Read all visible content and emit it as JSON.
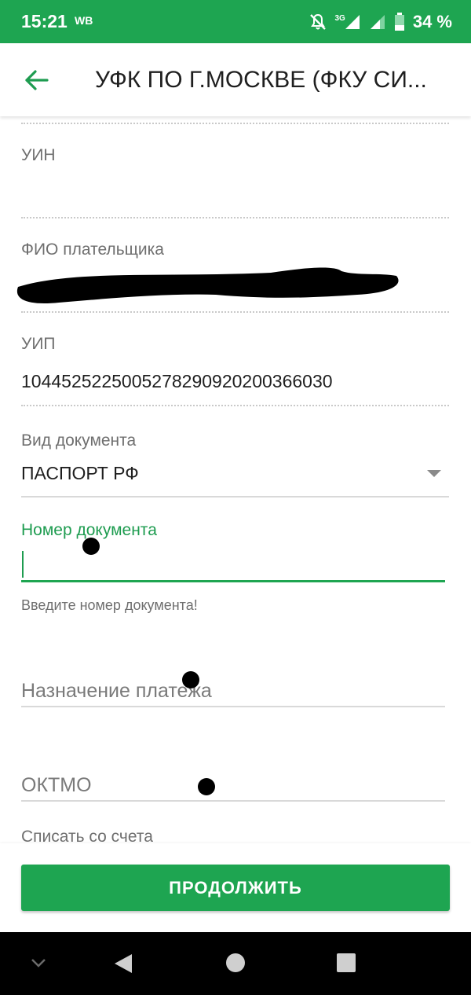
{
  "status_bar": {
    "time": "15:21",
    "carrier": "WB",
    "network": "3G",
    "battery": "34 %"
  },
  "header": {
    "title": "УФК ПО Г.МОСКВЕ (ФКУ СИ..."
  },
  "form": {
    "uin": {
      "label": "УИН",
      "value": ""
    },
    "payer_name": {
      "label": "ФИО плательщика"
    },
    "uip": {
      "label": "УИП",
      "value": "1044525225005278290920200366030"
    },
    "doc_type": {
      "label": "Вид документа",
      "value": "ПАСПОРТ РФ"
    },
    "doc_number": {
      "label": "Номер документа",
      "value": "",
      "error": "Введите номер документа!"
    },
    "purpose": {
      "placeholder": "Назначение платежа"
    },
    "oktmo": {
      "placeholder": "ОКТМО"
    },
    "debit_account": {
      "label": "Списать со счета"
    }
  },
  "actions": {
    "continue_label": "ПРОДОЛЖИТЬ"
  },
  "colors": {
    "brand_green": "#1ea551",
    "label_green": "#1e9c50"
  },
  "icons": [
    "back-arrow-icon",
    "bell-off-icon",
    "signal-icon",
    "battery-icon",
    "dropdown-arrow-icon",
    "nav-back-icon",
    "nav-home-icon",
    "nav-recents-icon",
    "nav-collapse-icon"
  ]
}
